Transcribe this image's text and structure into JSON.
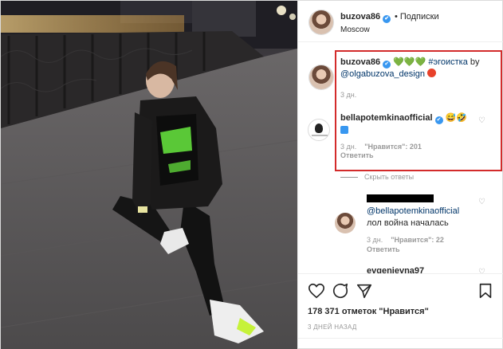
{
  "header": {
    "username": "buzova86",
    "verified_icon": "✔",
    "separator": "•",
    "follow_label": "Подписки",
    "location": "Moscow"
  },
  "caption": {
    "username": "buzova86",
    "hearts": "💚💚💚",
    "hashtag": "#эгоистка",
    "by": "by",
    "mention": "@olgabuzova_design",
    "time": "3 дн."
  },
  "comments": [
    {
      "username": "bellapotemkinaofficial",
      "emoji": "😅🤣",
      "time": "3 дн.",
      "likes": "\"Нравится\": 201",
      "reply_label": "Ответить"
    },
    {
      "mention": "@bellapotemkinaofficial",
      "text": "лол война началась",
      "time": "3 дн.",
      "likes": "\"Нравится\": 22",
      "reply_label": "Ответить"
    },
    {
      "username": "evgenievna97"
    }
  ],
  "hide_replies_label": "Скрыть ответы",
  "likes_count": "178 371 отметок \"Нравится\"",
  "posted_ago": "3 ДНЕЙ НАЗАД",
  "colors": {
    "highlight_border": "#d32b2b",
    "verified_blue": "#3897f0",
    "link_blue": "#003569",
    "heart_green": "#2bb741"
  }
}
